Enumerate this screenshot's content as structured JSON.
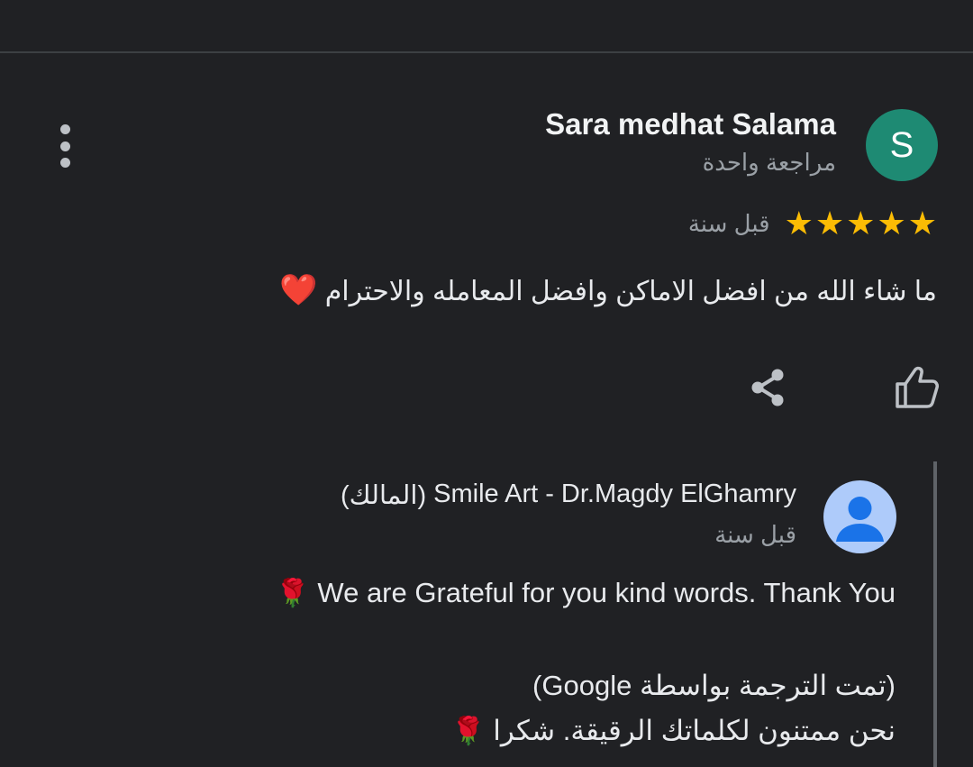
{
  "review": {
    "avatar_letter": "S",
    "author_name": "Sara medhat Salama",
    "author_reviews": "مراجعة واحدة",
    "stars": [
      "★",
      "★",
      "★",
      "★",
      "★"
    ],
    "rating": 5,
    "time": "قبل سنة",
    "text": "ما شاء الله من افضل الاماكن وافضل المعامله والاحترام",
    "text_emoji": "❤️"
  },
  "owner_reply": {
    "name": "Smile Art - Dr.Magdy ElGhamry",
    "owner_tag": "(المالك)",
    "time": "قبل سنة",
    "text_en": "We are Grateful for you kind words. Thank You",
    "rose": "🌹",
    "translation_note": "(تمت الترجمة بواسطة Google)",
    "text_ar": "نحن ممتنون لكلماتك الرقيقة. شكرا"
  },
  "icons": {
    "menu": "more-vert-icon",
    "like": "thumb-up-outline-icon",
    "share": "share-icon"
  },
  "colors": {
    "background": "#202124",
    "avatar": "#1e8a73",
    "star": "#fbbc04",
    "heart": "#ea3323",
    "owner_avatar": "#aecbfa",
    "owner_avatar_fg": "#1a73e8"
  }
}
